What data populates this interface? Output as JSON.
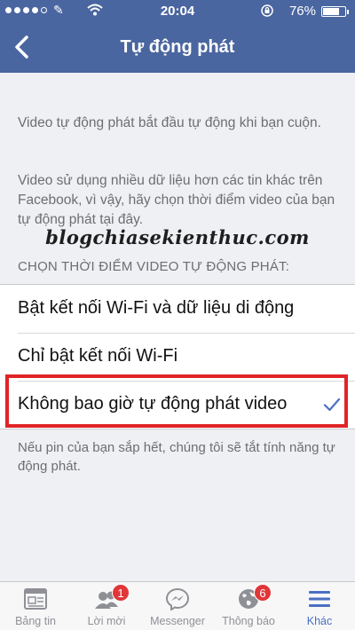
{
  "status_bar": {
    "carrier_glyph": "✎",
    "time": "20:04",
    "battery_percent": "76%",
    "battery_level": 0.76
  },
  "nav": {
    "title": "Tự động phát",
    "back_icon": "chevron-left-icon"
  },
  "description": {
    "paragraph1": "Video tự động phát bắt đầu tự động khi bạn cuộn.",
    "paragraph2": "Video sử dụng nhiều dữ liệu hơn các tin khác trên Facebook, vì vậy, hãy chọn thời điểm video của bạn tự động phát tại đây."
  },
  "watermark": "blogchiasekienthuc.com",
  "section_header": "CHỌN THỜI ĐIỂM VIDEO TỰ ĐỘNG PHÁT:",
  "options": [
    {
      "label": "Bật kết nối Wi-Fi và dữ liệu di động",
      "selected": false
    },
    {
      "label": "Chỉ bật kết nối Wi-Fi",
      "selected": false
    },
    {
      "label": "Không bao giờ tự động phát video",
      "selected": true
    }
  ],
  "footer_note": "Nếu pin của bạn sắp hết, chúng tôi sẽ tắt tính năng tự động phát.",
  "tabbar": {
    "tabs": [
      {
        "label": "Bảng tin",
        "icon": "news-feed-icon",
        "badge": ""
      },
      {
        "label": "Lời mời",
        "icon": "friend-requests-icon",
        "badge": "1"
      },
      {
        "label": "Messenger",
        "icon": "messenger-icon",
        "badge": ""
      },
      {
        "label": "Thông báo",
        "icon": "globe-notifications-icon",
        "badge": "6"
      },
      {
        "label": "Khác",
        "icon": "menu-icon",
        "badge": ""
      }
    ]
  },
  "colors": {
    "header_blue": "#4a66a0",
    "accent_blue": "#4a6fc3",
    "highlight_red": "#e02426",
    "badge_red": "#e0363a"
  }
}
